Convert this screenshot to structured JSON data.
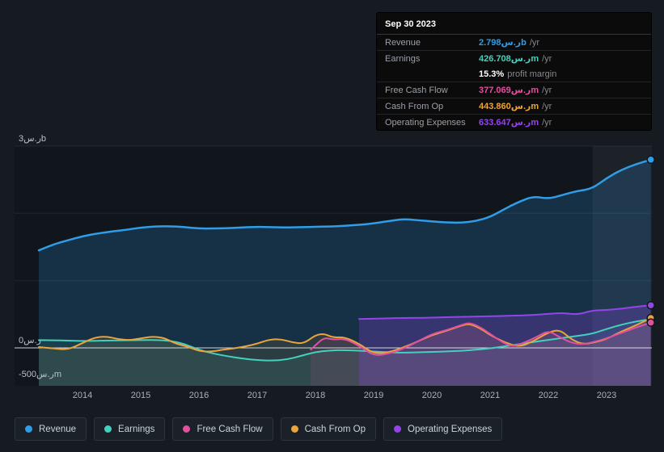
{
  "meta": {
    "currency_symbol": "ر.س"
  },
  "colors": {
    "revenue": "#2f9de8",
    "earnings": "#45d0bd",
    "free_cash_flow": "#e0519e",
    "cash_from_op": "#eba43c",
    "operating_expenses": "#9345ea",
    "white": "#ffffff",
    "page_bg": "#161b22",
    "plot_bg": "#11161d",
    "zero_line": "#e6e9ec",
    "tooltip_bg": "#0b0b0c"
  },
  "tooltip": {
    "date": "Sep 30 2023",
    "rows": [
      {
        "key": "revenue",
        "label": "Revenue",
        "value": "2.798ر.سb",
        "suffix": "/yr",
        "group_end": true
      },
      {
        "key": "earnings",
        "label": "Earnings",
        "value": "426.708ر.سm",
        "suffix": "/yr",
        "group_end": false
      },
      {
        "key": "white",
        "label": "",
        "value": "15.3%",
        "suffix": "profit margin",
        "group_end": true
      },
      {
        "key": "free_cash_flow",
        "label": "Free Cash Flow",
        "value": "377.069ر.سm",
        "suffix": "/yr",
        "group_end": true
      },
      {
        "key": "cash_from_op",
        "label": "Cash From Op",
        "value": "443.860ر.سm",
        "suffix": "/yr",
        "group_end": true
      },
      {
        "key": "operating_expenses",
        "label": "Operating Expenses",
        "value": "633.647ر.سm",
        "suffix": "/yr",
        "group_end": false
      }
    ]
  },
  "legend": {
    "items": [
      {
        "key": "revenue",
        "label": "Revenue"
      },
      {
        "key": "earnings",
        "label": "Earnings"
      },
      {
        "key": "free_cash_flow",
        "label": "Free Cash Flow"
      },
      {
        "key": "cash_from_op",
        "label": "Cash From Op"
      },
      {
        "key": "operating_expenses",
        "label": "Operating Expenses"
      }
    ]
  },
  "chart_data": {
    "type": "line",
    "unit": "SAR millions",
    "x_ticks": [
      2014,
      2015,
      2016,
      2017,
      2018,
      2019,
      2020,
      2021,
      2022,
      2023
    ],
    "y_ticks": [
      {
        "label": "3ر.سb",
        "value": 3000
      },
      {
        "label": "0ر.س",
        "value": 0
      },
      {
        "label": "-500ر.سm",
        "value": -500
      }
    ],
    "ylim": [
      -564,
      3000
    ],
    "xlim": [
      2013.25,
      2023.8
    ],
    "highlight_x_range": [
      2022.76,
      2023.78
    ],
    "series": [
      {
        "key": "revenue",
        "name": "Revenue",
        "points": [
          [
            2013.25,
            1450
          ],
          [
            2013.5,
            1540
          ],
          [
            2013.75,
            1600
          ],
          [
            2014,
            1660
          ],
          [
            2014.25,
            1700
          ],
          [
            2014.5,
            1730
          ],
          [
            2014.75,
            1755
          ],
          [
            2015,
            1790
          ],
          [
            2015.25,
            1805
          ],
          [
            2015.5,
            1810
          ],
          [
            2015.75,
            1795
          ],
          [
            2016,
            1775
          ],
          [
            2016.25,
            1775
          ],
          [
            2016.5,
            1780
          ],
          [
            2016.75,
            1790
          ],
          [
            2017,
            1800
          ],
          [
            2017.25,
            1795
          ],
          [
            2017.5,
            1790
          ],
          [
            2017.75,
            1795
          ],
          [
            2018,
            1800
          ],
          [
            2018.25,
            1805
          ],
          [
            2018.5,
            1815
          ],
          [
            2018.75,
            1830
          ],
          [
            2019,
            1850
          ],
          [
            2019.25,
            1885
          ],
          [
            2019.5,
            1915
          ],
          [
            2019.75,
            1900
          ],
          [
            2020,
            1880
          ],
          [
            2020.25,
            1865
          ],
          [
            2020.5,
            1860
          ],
          [
            2020.75,
            1885
          ],
          [
            2021,
            1945
          ],
          [
            2021.25,
            2065
          ],
          [
            2021.5,
            2175
          ],
          [
            2021.75,
            2255
          ],
          [
            2022,
            2215
          ],
          [
            2022.25,
            2275
          ],
          [
            2022.5,
            2335
          ],
          [
            2022.75,
            2365
          ],
          [
            2023,
            2525
          ],
          [
            2023.25,
            2645
          ],
          [
            2023.5,
            2730
          ],
          [
            2023.76,
            2798
          ]
        ]
      },
      {
        "key": "earnings",
        "name": "Earnings",
        "points": [
          [
            2013.25,
            115
          ],
          [
            2013.5,
            112
          ],
          [
            2013.75,
            108
          ],
          [
            2014,
            102
          ],
          [
            2014.25,
            105
          ],
          [
            2014.5,
            110
          ],
          [
            2014.75,
            112
          ],
          [
            2015,
            116
          ],
          [
            2015.25,
            118
          ],
          [
            2015.5,
            108
          ],
          [
            2015.75,
            60
          ],
          [
            2016,
            -30
          ],
          [
            2016.25,
            -85
          ],
          [
            2016.5,
            -125
          ],
          [
            2016.75,
            -160
          ],
          [
            2017,
            -182
          ],
          [
            2017.25,
            -190
          ],
          [
            2017.5,
            -175
          ],
          [
            2017.75,
            -120
          ],
          [
            2018,
            -60
          ],
          [
            2018.25,
            -38
          ],
          [
            2018.5,
            -32
          ],
          [
            2018.75,
            -42
          ],
          [
            2019,
            -55
          ],
          [
            2019.25,
            -65
          ],
          [
            2019.5,
            -72
          ],
          [
            2019.75,
            -66
          ],
          [
            2020,
            -60
          ],
          [
            2020.25,
            -52
          ],
          [
            2020.5,
            -44
          ],
          [
            2020.75,
            -28
          ],
          [
            2021,
            -8
          ],
          [
            2021.25,
            22
          ],
          [
            2021.5,
            55
          ],
          [
            2021.75,
            88
          ],
          [
            2022,
            118
          ],
          [
            2022.25,
            148
          ],
          [
            2022.5,
            178
          ],
          [
            2022.75,
            208
          ],
          [
            2023,
            282
          ],
          [
            2023.25,
            345
          ],
          [
            2023.5,
            392
          ],
          [
            2023.76,
            427
          ]
        ]
      },
      {
        "key": "cash_from_op",
        "name": "Cash From Op",
        "points": [
          [
            2013.25,
            12
          ],
          [
            2013.5,
            -8
          ],
          [
            2013.75,
            -28
          ],
          [
            2014,
            72
          ],
          [
            2014.2,
            152
          ],
          [
            2014.4,
            172
          ],
          [
            2014.6,
            132
          ],
          [
            2014.8,
            112
          ],
          [
            2015,
            142
          ],
          [
            2015.2,
            168
          ],
          [
            2015.4,
            152
          ],
          [
            2015.6,
            62
          ],
          [
            2015.8,
            22
          ],
          [
            2016,
            -48
          ],
          [
            2016.2,
            -58
          ],
          [
            2016.4,
            -28
          ],
          [
            2016.6,
            -8
          ],
          [
            2016.8,
            22
          ],
          [
            2017,
            62
          ],
          [
            2017.2,
            122
          ],
          [
            2017.4,
            132
          ],
          [
            2017.6,
            82
          ],
          [
            2017.8,
            62
          ],
          [
            2018,
            192
          ],
          [
            2018.15,
            212
          ],
          [
            2018.3,
            152
          ],
          [
            2018.5,
            162
          ],
          [
            2018.75,
            62
          ],
          [
            2019,
            -88
          ],
          [
            2019.25,
            -68
          ],
          [
            2019.5,
            2
          ],
          [
            2019.75,
            92
          ],
          [
            2020,
            192
          ],
          [
            2020.25,
            252
          ],
          [
            2020.5,
            332
          ],
          [
            2020.65,
            362
          ],
          [
            2020.85,
            282
          ],
          [
            2021,
            192
          ],
          [
            2021.25,
            82
          ],
          [
            2021.5,
            12
          ],
          [
            2021.75,
            102
          ],
          [
            2022,
            232
          ],
          [
            2022.2,
            272
          ],
          [
            2022.4,
            122
          ],
          [
            2022.6,
            52
          ],
          [
            2022.8,
            82
          ],
          [
            2023,
            132
          ],
          [
            2023.25,
            242
          ],
          [
            2023.5,
            332
          ],
          [
            2023.76,
            444
          ]
        ]
      },
      {
        "key": "free_cash_flow",
        "name": "Free Cash Flow",
        "points": [
          [
            2017.92,
            -25
          ],
          [
            2018,
            40
          ],
          [
            2018.15,
            155
          ],
          [
            2018.3,
            120
          ],
          [
            2018.5,
            138
          ],
          [
            2018.75,
            35
          ],
          [
            2019,
            -118
          ],
          [
            2019.25,
            -88
          ],
          [
            2019.5,
            -18
          ],
          [
            2019.75,
            92
          ],
          [
            2020,
            205
          ],
          [
            2020.25,
            262
          ],
          [
            2020.5,
            338
          ],
          [
            2020.65,
            378
          ],
          [
            2020.85,
            298
          ],
          [
            2021,
            208
          ],
          [
            2021.25,
            62
          ],
          [
            2021.4,
            22
          ],
          [
            2021.6,
            82
          ],
          [
            2021.8,
            162
          ],
          [
            2022,
            258
          ],
          [
            2022.2,
            158
          ],
          [
            2022.4,
            72
          ],
          [
            2022.6,
            52
          ],
          [
            2022.8,
            92
          ],
          [
            2023,
            142
          ],
          [
            2023.25,
            222
          ],
          [
            2023.5,
            302
          ],
          [
            2023.76,
            377
          ]
        ]
      },
      {
        "key": "operating_expenses",
        "name": "Operating Expenses",
        "points": [
          [
            2018.75,
            428
          ],
          [
            2019,
            434
          ],
          [
            2019.25,
            440
          ],
          [
            2019.5,
            445
          ],
          [
            2019.75,
            446
          ],
          [
            2020,
            450
          ],
          [
            2020.25,
            455
          ],
          [
            2020.5,
            461
          ],
          [
            2020.75,
            466
          ],
          [
            2021,
            470
          ],
          [
            2021.25,
            476
          ],
          [
            2021.5,
            481
          ],
          [
            2021.75,
            490
          ],
          [
            2022,
            506
          ],
          [
            2022.25,
            522
          ],
          [
            2022.5,
            492
          ],
          [
            2022.75,
            556
          ],
          [
            2023,
            562
          ],
          [
            2023.25,
            582
          ],
          [
            2023.5,
            612
          ],
          [
            2023.76,
            634
          ]
        ]
      }
    ]
  }
}
